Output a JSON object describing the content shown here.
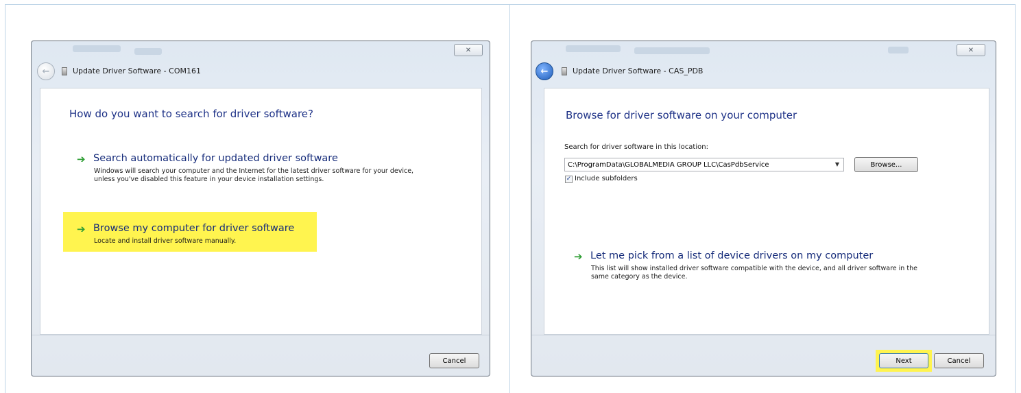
{
  "left_dialog": {
    "title": "Update Driver Software - COM161",
    "close_glyph": "✕",
    "back_glyph": "←",
    "heading": "How do you want to search for driver software?",
    "options": [
      {
        "arrow": "➔",
        "title": "Search automatically for updated driver software",
        "description": "Windows will search your computer and the Internet for the latest driver software for your device, unless you've disabled this feature in your device installation settings.",
        "highlighted": false
      },
      {
        "arrow": "➔",
        "title": "Browse my computer for driver software",
        "description": "Locate and install driver software manually.",
        "highlighted": true
      }
    ],
    "cancel_label": "Cancel"
  },
  "right_dialog": {
    "title": "Update Driver Software - CAS_PDB",
    "close_glyph": "✕",
    "back_glyph": "←",
    "heading": "Browse for driver software on your computer",
    "search_label": "Search for driver software in this location:",
    "path_value": "C:\\ProgramData\\GLOBALMEDIA GROUP LLC\\CasPdbService",
    "combo_arrow": "▼",
    "browse_label": "Browse...",
    "include_subfolders_label": "Include subfolders",
    "include_subfolders_checked": true,
    "check_glyph": "✓",
    "pick_option": {
      "arrow": "➔",
      "title": "Let me pick from a list of device drivers on my computer",
      "description": "This list will show installed driver software compatible with the device, and all driver software in the same category as the device."
    },
    "next_label": "Next",
    "cancel_label": "Cancel"
  },
  "colors": {
    "highlight": "#fff44f",
    "heading_blue": "#1e3287",
    "arrow_green": "#2f9e35"
  }
}
